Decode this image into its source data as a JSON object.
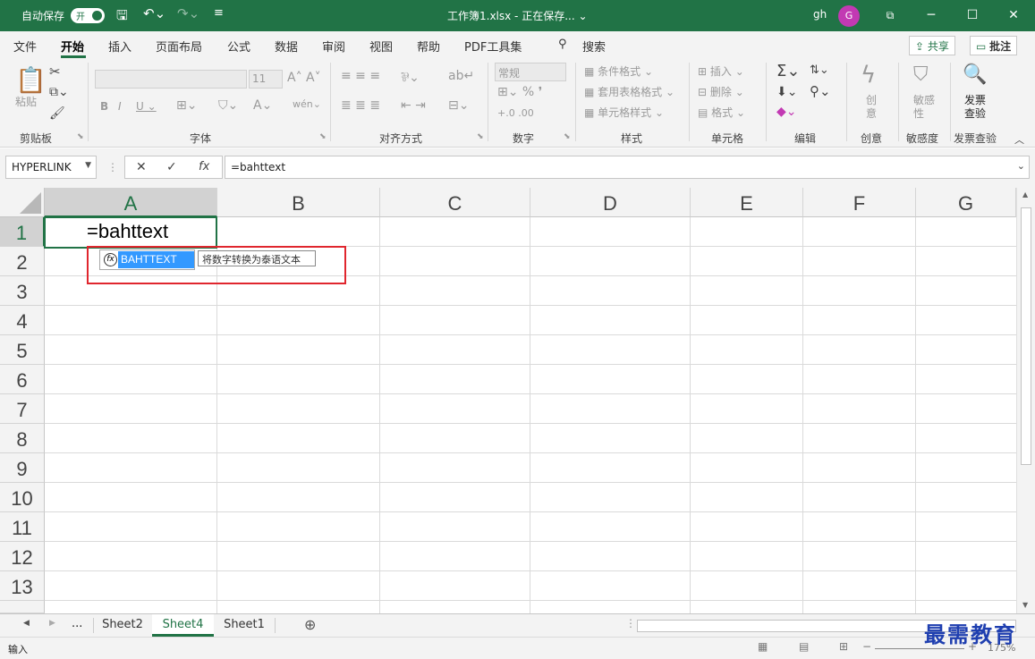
{
  "titlebar": {
    "autosave_label": "自动保存",
    "autosave_state": "开",
    "doc_title": "工作簿1.xlsx - 正在保存... ⌄",
    "user_initials": "gh",
    "avatar_letter": "G"
  },
  "tabs": [
    "文件",
    "开始",
    "插入",
    "页面布局",
    "公式",
    "数据",
    "审阅",
    "视图",
    "帮助",
    "PDF工具集",
    "搜索"
  ],
  "tab_actions": {
    "share": "共享",
    "comment": "批注"
  },
  "ribbon": {
    "paste": "粘贴",
    "clipboard": "剪贴板",
    "font_group": "字体",
    "font_size": "11",
    "align_group": "对齐方式",
    "number_format": "常规",
    "number_group": "数字",
    "conditional": "条件格式",
    "table_format": "套用表格格式",
    "cell_style": "单元格样式",
    "style_group": "样式",
    "insert": "插入",
    "delete": "删除",
    "format": "格式",
    "cells_group": "单元格",
    "edit_group": "编辑",
    "create_btn": "创意",
    "create_group": "创意",
    "sensitivity_btn": "敏感性",
    "sensitivity_group": "敏感度",
    "invoice_btn": "发票查验",
    "invoice_group": "发票查验"
  },
  "formula_bar": {
    "name_box": "HYPERLINK",
    "formula": "=bahttext"
  },
  "grid": {
    "columns": [
      "A",
      "B",
      "C",
      "D",
      "E",
      "F",
      "G"
    ],
    "rows": [
      "1",
      "2",
      "3",
      "4",
      "5",
      "6",
      "7",
      "8",
      "9",
      "10",
      "11",
      "12",
      "13"
    ],
    "active_cell_text": "=bahttext",
    "autocomplete_item": "BAHTTEXT",
    "autocomplete_fx": "fx",
    "autocomplete_tip": "将数字转换为泰语文本"
  },
  "sheets": {
    "more": "...",
    "tabs": [
      "Sheet2",
      "Sheet4",
      "Sheet1"
    ]
  },
  "status": {
    "mode": "输入",
    "zoom": "175%"
  },
  "watermark": "最需教育",
  "colors": {
    "excel_green": "#217346",
    "highlight": "#3399ff",
    "annotation_red": "#e0262e"
  }
}
